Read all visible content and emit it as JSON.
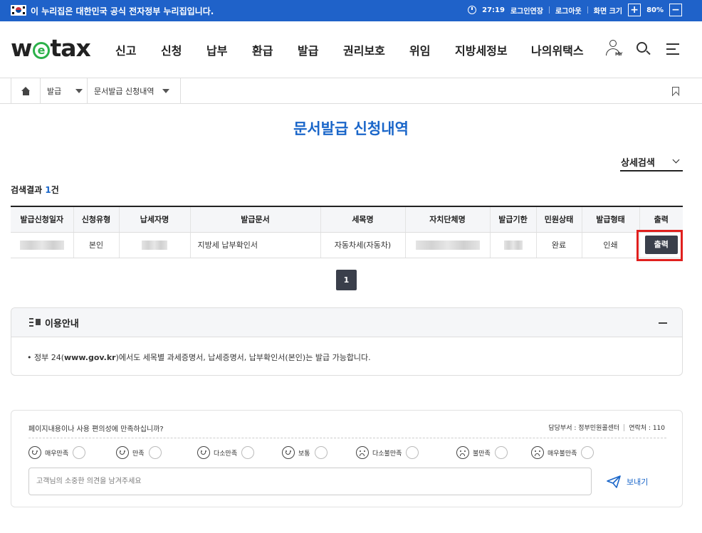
{
  "gov_banner": {
    "text": "이 누리집은 대한민국 공식 전자정부 누리집입니다.",
    "timer": "27:19",
    "extend_login": "로그인연장",
    "logout": "로그아웃",
    "font_size_label": "화면 크기",
    "zoom_in": "+",
    "zoom_level": "80%",
    "zoom_out": "−"
  },
  "header": {
    "logo_w": "w",
    "logo_e": "e",
    "logo_tax": "tax",
    "nav": [
      "신고",
      "신청",
      "납부",
      "환급",
      "발급",
      "권리보호",
      "위임",
      "지방세정보",
      "나의위택스"
    ],
    "my_label": "MY"
  },
  "breadcrumb": {
    "level1": "발급",
    "level2": "문서발급 신청내역"
  },
  "page_title": "문서발급 신청내역",
  "detail_search_label": "상세검색",
  "result": {
    "prefix": "검색결과 ",
    "count": "1",
    "suffix": "건"
  },
  "table": {
    "headers": [
      "발급신청일자",
      "신청유형",
      "납세자명",
      "발급문서",
      "세목명",
      "자치단체명",
      "발급기한",
      "민원상태",
      "발급형태",
      "출력"
    ],
    "rows": [
      {
        "type": "본인",
        "document": "지방세 납부확인서",
        "tax_item": "자동차세(자동차)",
        "status": "완료",
        "issue_form": "인쇄",
        "print_label": "출력"
      }
    ]
  },
  "pagination": {
    "current": "1"
  },
  "guide": {
    "title": "이용안내",
    "bullet": "• 정부 24(",
    "site": "www.gov.kr",
    "rest": ")에서도 세목별 과세증명서, 납세증명서, 납부확인서(본인)는 발급 가능합니다."
  },
  "feedback": {
    "question": "페이지내용이나 사용 편의성에 만족하십니까?",
    "dept": "담당부서 : 정부민원콜센터",
    "contact": "연락처 : 110",
    "ratings": [
      "매우만족",
      "만족",
      "다소만족",
      "보통",
      "다소불만족",
      "불만족",
      "매우불만족"
    ],
    "placeholder": "고객님의 소중한 의견을 남겨주세요",
    "send_label": "보내기"
  },
  "colors": {
    "gov_bar": "#1f62c9",
    "accent_blue": "#1a66c9",
    "logo_green": "#2cb14a",
    "dark_button": "#3a3f4b",
    "highlight_red": "#e0201e"
  }
}
